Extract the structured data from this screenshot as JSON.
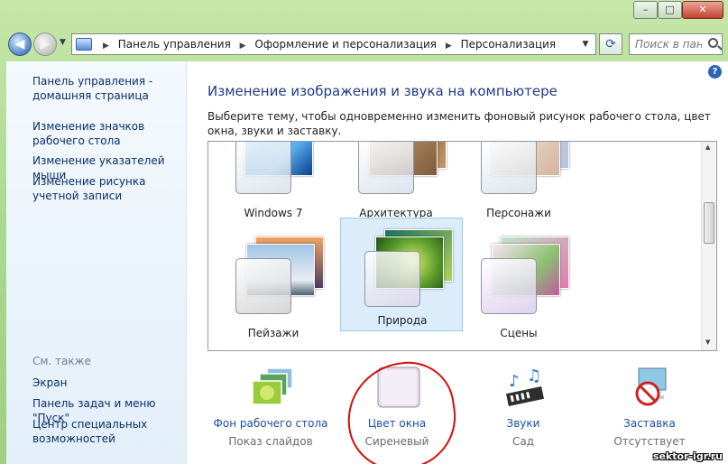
{
  "navbar": {
    "crumbs": [
      "Панель управления",
      "Оформление и персонализация",
      "Персонализация"
    ],
    "search_placeholder": "Поиск в пан"
  },
  "sidebar": {
    "home": "Панель управления - домашняя страница",
    "links": [
      "Изменение значков рабочего стола",
      "Изменение указателей мыши",
      "Изменение рисунка учетной записи"
    ],
    "see_also_title": "См. также",
    "see_also": [
      "Экран",
      "Панель задач и меню \"Пуск\"",
      "Центр специальных возможностей"
    ]
  },
  "main": {
    "heading": "Изменение изображения и звука на компьютере",
    "description": "Выберите тему, чтобы одновременно изменить фоновый рисунок рабочего стола, цвет окна, звуки и заставку.",
    "themes": [
      {
        "name": "Windows 7",
        "selected": false
      },
      {
        "name": "Архитектура",
        "selected": false
      },
      {
        "name": "Персонажи",
        "selected": false
      },
      {
        "name": "Пейзажи",
        "selected": false
      },
      {
        "name": "Природа",
        "selected": true
      },
      {
        "name": "Сцены",
        "selected": false
      }
    ],
    "options": [
      {
        "label": "Фон рабочего стола",
        "value": "Показ слайдов"
      },
      {
        "label": "Цвет окна",
        "value": "Сиреневый"
      },
      {
        "label": "Звуки",
        "value": "Сад"
      },
      {
        "label": "Заставка",
        "value": "Отсутствует"
      }
    ]
  },
  "watermark": "sektor-igr.ru",
  "colors": {
    "link": "#1a50a8",
    "heading": "#1e3b8a",
    "annotation": "#d40c0c",
    "frame": "#a9d98d"
  }
}
